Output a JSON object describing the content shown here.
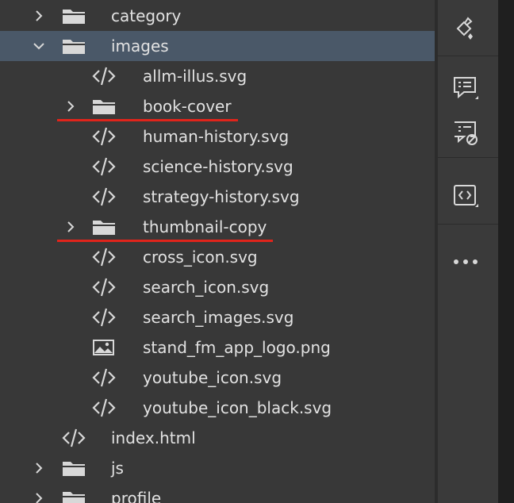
{
  "tree": {
    "items": [
      {
        "label": "category",
        "kind": "folder",
        "depth": 0,
        "chevron": "right",
        "selected": false
      },
      {
        "label": "images",
        "kind": "folder",
        "depth": 0,
        "chevron": "down",
        "selected": true
      },
      {
        "label": "allm-illus.svg",
        "kind": "code",
        "depth": 1
      },
      {
        "label": "book-cover",
        "kind": "folder",
        "depth": 1,
        "chevron": "right",
        "highlight": true
      },
      {
        "label": "human-history.svg",
        "kind": "code",
        "depth": 1
      },
      {
        "label": "science-history.svg",
        "kind": "code",
        "depth": 1
      },
      {
        "label": "strategy-history.svg",
        "kind": "code",
        "depth": 1
      },
      {
        "label": "thumbnail-copy",
        "kind": "folder",
        "depth": 1,
        "chevron": "right",
        "highlight": true
      },
      {
        "label": "cross_icon.svg",
        "kind": "code",
        "depth": 1
      },
      {
        "label": "search_icon.svg",
        "kind": "code",
        "depth": 1
      },
      {
        "label": "search_images.svg",
        "kind": "code",
        "depth": 1
      },
      {
        "label": "stand_fm_app_logo.png",
        "kind": "image",
        "depth": 1
      },
      {
        "label": "youtube_icon.svg",
        "kind": "code",
        "depth": 1
      },
      {
        "label": "youtube_icon_black.svg",
        "kind": "code",
        "depth": 1
      },
      {
        "label": "index.html",
        "kind": "code",
        "depth": 0
      },
      {
        "label": "js",
        "kind": "folder",
        "depth": 0,
        "chevron": "right"
      },
      {
        "label": "profile",
        "kind": "folder",
        "depth": 0,
        "chevron": "right"
      }
    ]
  },
  "toolbar": {
    "buttons": [
      {
        "name": "paint-bucket-icon"
      },
      {
        "name": "comment-icon"
      },
      {
        "name": "comment-disabled-icon"
      },
      {
        "name": "code-view-icon"
      },
      {
        "name": "more-icon"
      }
    ]
  },
  "colors": {
    "background": "#383838",
    "selected_row": "#4a5868",
    "text": "#e2e2e2",
    "highlight_underline": "#e0241b"
  }
}
